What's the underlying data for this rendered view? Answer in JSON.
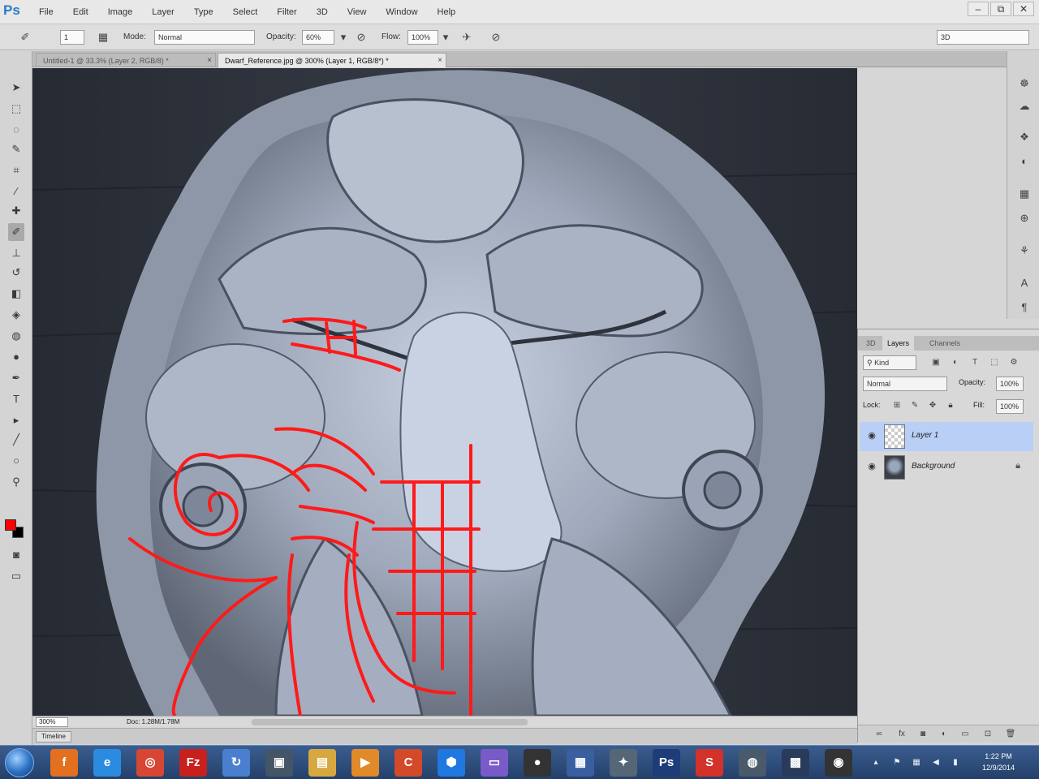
{
  "app": {
    "logo": "Ps"
  },
  "menus": [
    "File",
    "Edit",
    "Image",
    "Layer",
    "Type",
    "Select",
    "Filter",
    "3D",
    "View",
    "Window",
    "Help"
  ],
  "window_controls": {
    "minimize": "–",
    "restore": "⧉",
    "close": "✕"
  },
  "options": {
    "brush_size": "1",
    "mode_label": "Mode:",
    "mode_value": "Normal",
    "opacity_label": "Opacity:",
    "opacity_value": "60%",
    "flow_label": "Flow:",
    "flow_value": "100%",
    "workspace": "3D"
  },
  "tabs": [
    {
      "label": "Untitled-1 @ 33.3% (Layer 2, RGB/8) *",
      "close": "×"
    },
    {
      "label": "Dwarf_Reference.jpg @ 300% (Layer 1, RGB/8*) *",
      "close": "×"
    }
  ],
  "tools": [
    {
      "name": "move-tool",
      "glyph": "➤"
    },
    {
      "name": "marquee-tool",
      "glyph": "⬚"
    },
    {
      "name": "lasso-tool",
      "glyph": "◌"
    },
    {
      "name": "quick-select-tool",
      "glyph": "✎"
    },
    {
      "name": "crop-tool",
      "glyph": "⌗"
    },
    {
      "name": "eyedropper-tool",
      "glyph": "⁄"
    },
    {
      "name": "healing-tool",
      "glyph": "✚"
    },
    {
      "name": "brush-tool",
      "glyph": "✐"
    },
    {
      "name": "clone-stamp-tool",
      "glyph": "⊥"
    },
    {
      "name": "history-brush-tool",
      "glyph": "↺"
    },
    {
      "name": "eraser-tool",
      "glyph": "◧"
    },
    {
      "name": "paint-bucket-tool",
      "glyph": "◈"
    },
    {
      "name": "blur-tool",
      "glyph": "◍"
    },
    {
      "name": "dodge-tool",
      "glyph": "●"
    },
    {
      "name": "pen-tool",
      "glyph": "✒"
    },
    {
      "name": "type-tool",
      "glyph": "T"
    },
    {
      "name": "path-select-tool",
      "glyph": "▸"
    },
    {
      "name": "line-tool",
      "glyph": "╱"
    },
    {
      "name": "shape-tool",
      "glyph": "○"
    },
    {
      "name": "zoom-tool",
      "glyph": "⚲"
    }
  ],
  "dock_icons": [
    "history-icon",
    "actions-icon",
    "3d-icon",
    "properties-icon",
    "adjustments-icon",
    "swatches-icon",
    "clone-source-icon",
    "character-icon",
    "paragraph-icon"
  ],
  "layers_panel": {
    "tabs": [
      "3D",
      "Layers",
      "Channels"
    ],
    "kind_label": "Kind",
    "blend_mode": "Normal",
    "opacity_label": "Opacity:",
    "opacity_value": "100%",
    "lock_label": "Lock:",
    "fill_label": "Fill:",
    "fill_value": "100%",
    "layers": [
      {
        "name": "Layer 1",
        "visible": true,
        "selected": true,
        "locked": false
      },
      {
        "name": "Background",
        "visible": true,
        "selected": false,
        "locked": true
      }
    ],
    "footer_icons": [
      "link-icon",
      "fx-icon",
      "mask-icon",
      "adjustment-icon",
      "group-icon",
      "new-layer-icon",
      "trash-icon"
    ]
  },
  "status": {
    "zoom": "300%",
    "doc_size": "Doc: 1.28M/1.78M"
  },
  "timeline": {
    "label": "Timeline"
  },
  "taskbar": {
    "apps": [
      "windows-explorer",
      "firefox",
      "internet-explorer",
      "chrome",
      "filezilla",
      "sync",
      "media",
      "folder",
      "media-player",
      "ccleaner",
      "dropbox",
      "app",
      "avatar",
      "monitor",
      "game",
      "photoshop",
      "record",
      "drive",
      "mixer",
      "recorder"
    ],
    "clock_time": "1:22 PM",
    "clock_date": "12/9/2014"
  },
  "colors": {
    "accent": "#2a7ac8",
    "foreground_swatch": "#ff0000",
    "background_swatch": "#000000",
    "overlay_stroke": "#ff1a1a"
  }
}
